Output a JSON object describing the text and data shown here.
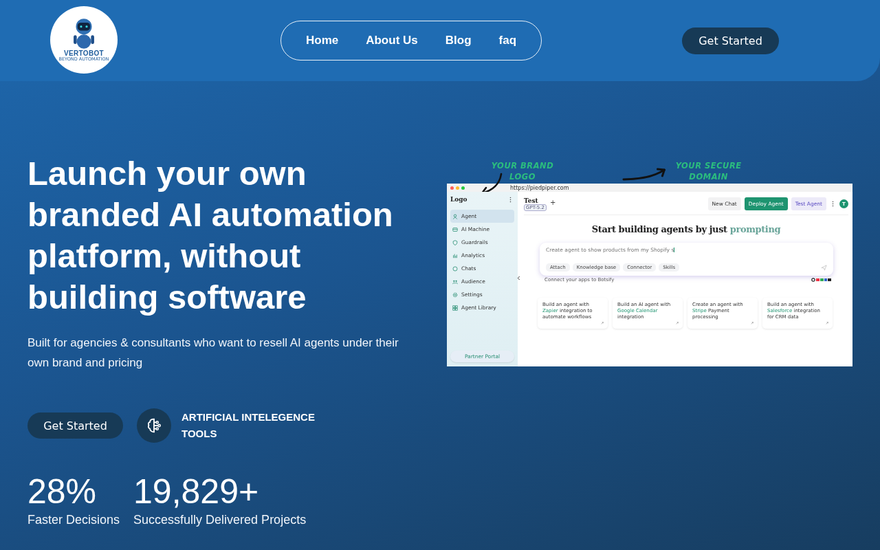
{
  "header": {
    "logo": {
      "name": "VERTOBOT",
      "tagline": "BEYOND AUTOMATION"
    },
    "nav": [
      {
        "label": "Home"
      },
      {
        "label": "About Us"
      },
      {
        "label": "Blog"
      },
      {
        "label": "faq"
      }
    ],
    "cta": "Get Started"
  },
  "hero": {
    "title": "Launch your own branded AI automation platform, without building software",
    "subtitle": "Built for agencies & consultants who want to resell AI agents under their own brand and pricing",
    "cta": "Get Started",
    "feature": "ARTIFICIAL INTELEGENCE TOOLS",
    "stats": [
      {
        "value": "28%",
        "label": "Faster Decisions"
      },
      {
        "value": "19,829+",
        "label": "Successfully Delivered Projects"
      }
    ]
  },
  "mockup": {
    "annotations": [
      "YOUR BRAND LOGO",
      "YOUR SECURE DOMAIN"
    ],
    "url": "https://piedpiper.com",
    "sidebar": {
      "logo": "Logo",
      "items": [
        {
          "label": "Agent",
          "selected": true
        },
        {
          "label": "AI Machine",
          "selected": false
        },
        {
          "label": "Guardrails",
          "selected": false
        },
        {
          "label": "Analytics",
          "selected": false
        },
        {
          "label": "Chats",
          "selected": false
        },
        {
          "label": "Audience",
          "selected": false
        },
        {
          "label": "Settings",
          "selected": false
        },
        {
          "label": "Agent Library",
          "selected": false
        }
      ],
      "footer": "Partner Portal"
    },
    "topbar": {
      "title": "Test",
      "model": "GPT-5.2",
      "add": "+",
      "buttons": [
        {
          "label": "New Chat",
          "kind": "plain"
        },
        {
          "label": "Deploy Agent",
          "kind": "primary"
        },
        {
          "label": "Test Agent",
          "kind": "soft"
        }
      ],
      "avatar": "T"
    },
    "heading": {
      "text": "Start building agents by just",
      "highlight": "prompting"
    },
    "prompt": {
      "value": "Create agent to show products from my Shopify s",
      "chips": [
        {
          "label": "Attach"
        },
        {
          "label": "Knowledge base"
        },
        {
          "label": "Connector"
        },
        {
          "label": "Skills"
        }
      ],
      "hint": "Connect your apps to Botsify"
    },
    "cards": [
      {
        "before": "Build an agent with",
        "highlight": "Zapier",
        "after": "integration to automate workflows"
      },
      {
        "before": "Build an AI agent with",
        "highlight": "Google Calendar",
        "after": "integration"
      },
      {
        "before": "Create an agent with",
        "highlight": "Stripe",
        "after": "Payment processing"
      },
      {
        "before": "Build an agent with",
        "highlight": "Salesforce",
        "after": "integration for CRM data"
      }
    ]
  }
}
